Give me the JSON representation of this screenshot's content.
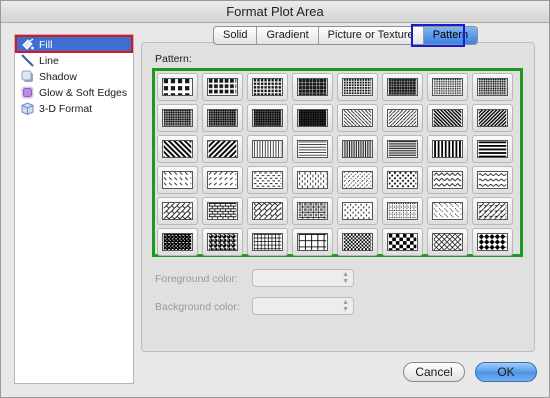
{
  "window": {
    "title": "Format Plot Area"
  },
  "sidebar": {
    "items": [
      {
        "label": "Fill",
        "icon": "paint-bucket-icon",
        "selected": true
      },
      {
        "label": "Line",
        "icon": "line-pen-icon",
        "selected": false
      },
      {
        "label": "Shadow",
        "icon": "shadow-icon",
        "selected": false
      },
      {
        "label": "Glow & Soft Edges",
        "icon": "glow-icon",
        "selected": false
      },
      {
        "label": "3-D Format",
        "icon": "cube-icon",
        "selected": false
      }
    ]
  },
  "tabs": [
    {
      "label": "Solid",
      "active": false
    },
    {
      "label": "Gradient",
      "active": false
    },
    {
      "label": "Picture or Texture",
      "active": false
    },
    {
      "label": "Pattern",
      "active": true
    }
  ],
  "pattern": {
    "label": "Pattern:",
    "swatches": [
      "dots-5",
      "dots-10",
      "dots-20",
      "dots-25",
      "dots-30",
      "dots-40",
      "dots-50",
      "dots-60",
      "dots-70",
      "dots-75",
      "dots-80",
      "dots-90",
      "light-downward-diagonal",
      "light-upward-diagonal",
      "dark-downward-diagonal",
      "dark-upward-diagonal",
      "wide-downward-diagonal",
      "wide-upward-diagonal",
      "light-vertical",
      "light-horizontal",
      "narrow-vertical",
      "narrow-horizontal",
      "dark-vertical",
      "dark-horizontal",
      "dashed-downward-diagonal",
      "dashed-upward-diagonal",
      "dashed-horizontal",
      "dashed-vertical",
      "small-confetti",
      "large-confetti",
      "zig-zag",
      "wave",
      "diagonal-brick",
      "horizontal-brick",
      "weave",
      "plaid",
      "divot",
      "dotted-grid",
      "dotted-diamond",
      "shingle",
      "trellis",
      "sphere",
      "small-grid",
      "large-grid",
      "small-checker-board",
      "large-checker-board",
      "outlined-diamond",
      "solid-diamond"
    ]
  },
  "foreground": {
    "label": "Foreground color:"
  },
  "background": {
    "label": "Background color:"
  },
  "buttons": {
    "cancel": "Cancel",
    "ok": "OK"
  },
  "colors": {
    "selection": "#3d6fd1",
    "ok_button": "#4d94e6",
    "annotation_red": "#e0141c",
    "annotation_blue": "#1a1ad6",
    "annotation_green": "#1c9a1c"
  }
}
